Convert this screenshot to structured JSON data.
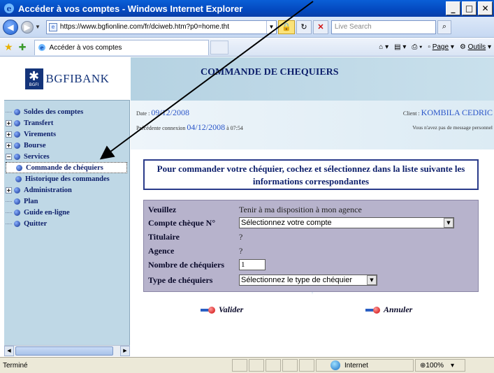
{
  "window": {
    "title": "Accéder à vos comptes - Windows Internet Explorer",
    "minimize": "_",
    "maximize": "□",
    "close": "✕"
  },
  "address": {
    "url": "https://www.bgfionline.com/fr/dciweb.htm?p0=home.tht",
    "search_placeholder": "Live Search"
  },
  "tab": {
    "label": "Accéder à vos comptes"
  },
  "commands": {
    "page": "Page",
    "tools": "Outils"
  },
  "brand": {
    "logo_text": "BGFIBANK",
    "logo_sub": "BGFI"
  },
  "menu": {
    "items": [
      {
        "label": "Soldes des comptes"
      },
      {
        "label": "Transfert"
      },
      {
        "label": "Virements"
      },
      {
        "label": "Bourse"
      },
      {
        "label": "Services"
      },
      {
        "label": "Commande de chéquiers"
      },
      {
        "label": "Historique des commandes"
      },
      {
        "label": "Administration"
      },
      {
        "label": "Plan"
      },
      {
        "label": "Guide en-ligne"
      },
      {
        "label": "Quitter"
      }
    ]
  },
  "page": {
    "title": "COMMANDE DE CHEQUIERS",
    "date_label": "Date : ",
    "date_value": "09/12/2008",
    "last_conn_label": "Précédente connexion",
    "last_conn_value": "04/12/2008",
    "last_conn_time": " à 07:54",
    "client_label": "Client : ",
    "client_value": "KOMBILA CEDRIC",
    "no_message": "Vous n'avez pas de message personnel",
    "instructions": "Pour commander votre chéquier, cochez et sélectionnez dans la liste suivante les informations correspondantes"
  },
  "form": {
    "veuillez_label": "Veuillez",
    "veuillez_value": "Tenir à ma disposition à mon agence",
    "compte_label": "Compte chèque N°",
    "compte_value": "Sélectionnez votre compte",
    "titulaire_label": "Titulaire",
    "titulaire_value": "?",
    "agence_label": "Agence",
    "agence_value": "?",
    "nombre_label": "Nombre de chéquiers",
    "nombre_value": "1",
    "type_label": "Type de chéquiers",
    "type_value": "Sélectionnez le type de chéquier"
  },
  "actions": {
    "validate": "Valider",
    "cancel": "Annuler"
  },
  "status": {
    "text": "Terminé",
    "zone": "Internet",
    "zoom": "100%"
  }
}
